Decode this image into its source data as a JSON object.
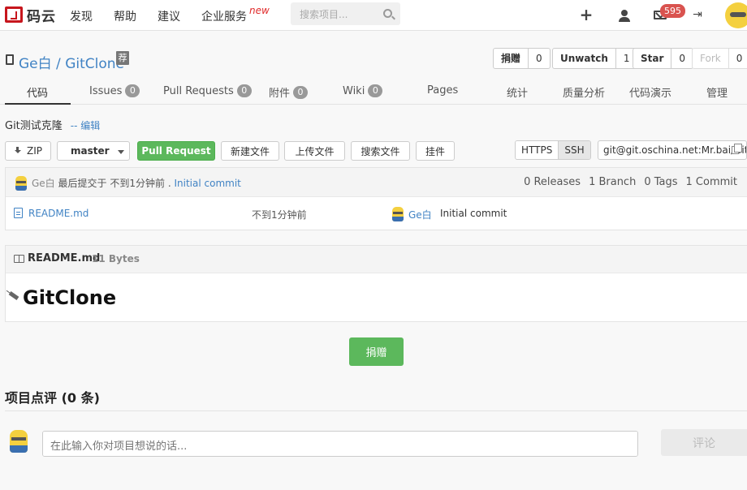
{
  "navbar": {
    "logo_text": "码云",
    "links": [
      "发现",
      "帮助",
      "建议",
      "企业服务"
    ],
    "new_tag": "new",
    "search_placeholder": "搜索项目...",
    "message_count": "595"
  },
  "repo": {
    "owner": "Ge白",
    "separator": "/",
    "name": "GitClone",
    "recommend_tag": "荐",
    "actions": [
      {
        "label": "捐赠",
        "count": "0"
      },
      {
        "label": "Unwatch",
        "count": "1"
      },
      {
        "label": "Star",
        "count": "0"
      },
      {
        "label": "Fork",
        "count": "0"
      }
    ]
  },
  "tabs": [
    {
      "label": "代码",
      "badge": ""
    },
    {
      "label": "Issues",
      "badge": "0"
    },
    {
      "label": "Pull Requests",
      "badge": "0"
    },
    {
      "label": "附件",
      "badge": "0"
    },
    {
      "label": "Wiki",
      "badge": "0"
    },
    {
      "label": "Pages",
      "badge": ""
    },
    {
      "label": "统计",
      "badge": ""
    },
    {
      "label": "质量分析",
      "badge": ""
    },
    {
      "label": "代码演示",
      "badge": ""
    },
    {
      "label": "管理",
      "badge": ""
    }
  ],
  "description": {
    "text": "Git测试克隆",
    "edit_link": "-- 编辑"
  },
  "toolbar": {
    "zip": "ZIP",
    "branch": "master",
    "pull_request": "Pull Request",
    "new_file": "新建文件",
    "upload_file": "上传文件",
    "search_file": "搜索文件",
    "mount": "挂件",
    "protocols": [
      "HTTPS",
      "SSH"
    ],
    "clone_url": "git@git.oschina.net:Mr.bai/GitClone.git"
  },
  "commit": {
    "author": "Ge白",
    "prefix": "最后提交于",
    "time": "不到1分钟前",
    "dot": ".",
    "message": "Initial commit",
    "stats": [
      "0 Releases",
      "1 Branch",
      "0 Tags",
      "1 Commit"
    ]
  },
  "files": [
    {
      "name": "README.md",
      "time": "不到1分钟前",
      "author": "Ge白",
      "message": "Initial commit"
    }
  ],
  "readme": {
    "filename": "README.md",
    "size": "11 Bytes",
    "heading": "GitClone"
  },
  "donate_label": "捐赠",
  "comments": {
    "title": "项目点评 (0 条)",
    "placeholder": "在此输入你对项目想说的话...",
    "submit": "评论"
  }
}
